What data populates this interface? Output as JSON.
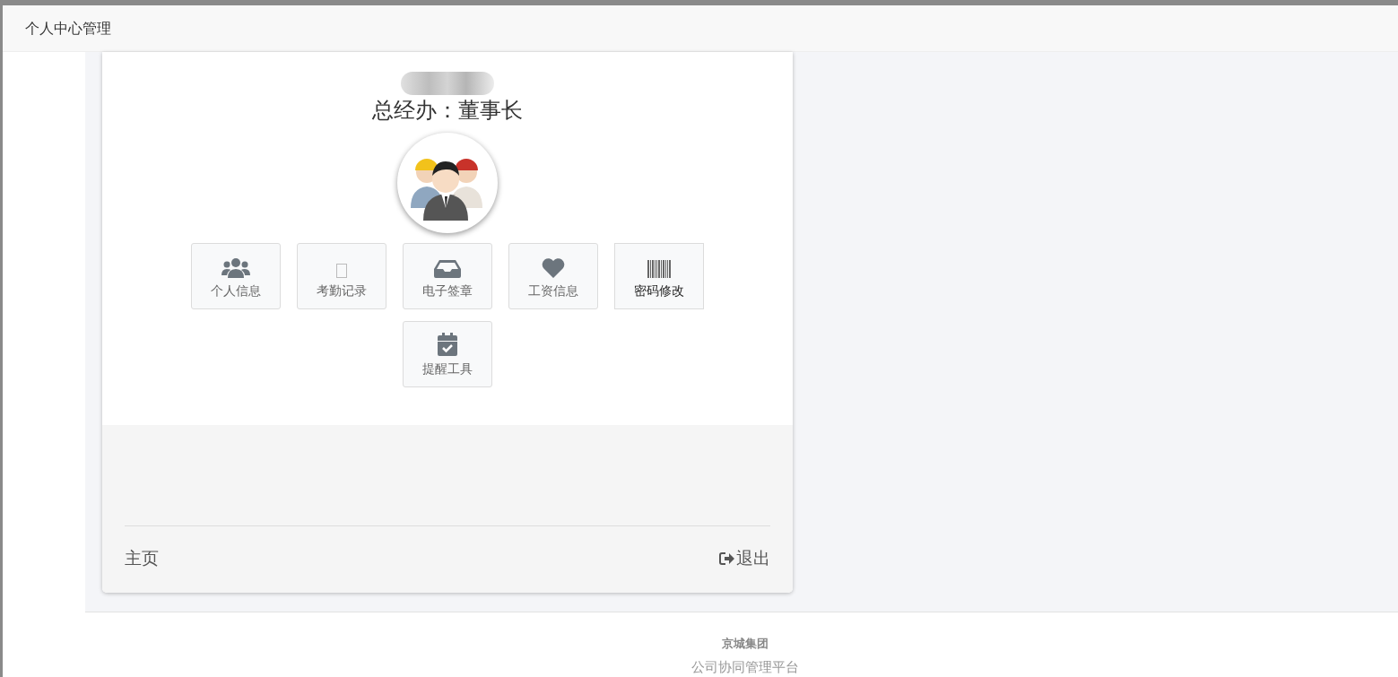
{
  "dialog": {
    "title": "个人中心管理"
  },
  "profile": {
    "position": "总经办：董事长"
  },
  "tiles": [
    {
      "label": "个人信息"
    },
    {
      "label": "考勤记录"
    },
    {
      "label": "电子签章"
    },
    {
      "label": "工资信息"
    },
    {
      "label": "密码修改"
    },
    {
      "label": "提醒工具"
    }
  ],
  "card_footer": {
    "home": "主页",
    "logout": "退出"
  },
  "page_footer": {
    "company": "京城集团",
    "platform": "公司协同管理平台"
  }
}
